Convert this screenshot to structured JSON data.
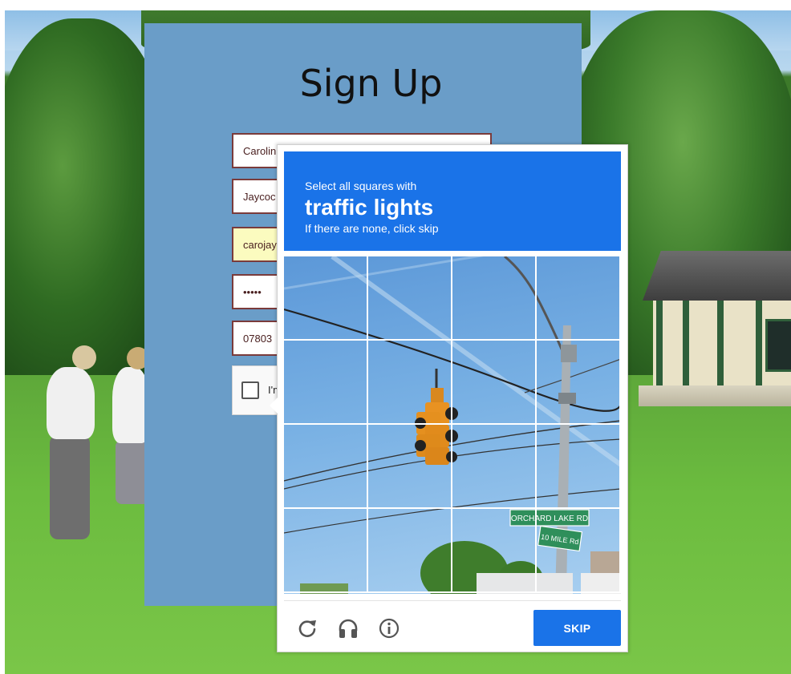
{
  "signup": {
    "title": "Sign Up",
    "fields": {
      "first_name": "Carolin",
      "last_name": "Jaycoc",
      "email": "carojay",
      "password": "•••••",
      "phone": "07803"
    },
    "recaptcha_label": "I'm"
  },
  "captcha": {
    "instruction": "Select all squares with",
    "target": "traffic lights",
    "hint": "If there are none, click skip",
    "skip_label": "SKIP",
    "street_signs": [
      "ORCHARD LAKE RD",
      "10 MILE Rd"
    ],
    "icons": {
      "reload": "reload-icon",
      "audio": "headphones-icon",
      "info": "info-icon"
    }
  },
  "colors": {
    "captcha_blue": "#1a73e8",
    "panel_blue": "#6a9dc8",
    "field_border": "#7a3b3b",
    "autofill_yellow": "#fbfbbf"
  }
}
